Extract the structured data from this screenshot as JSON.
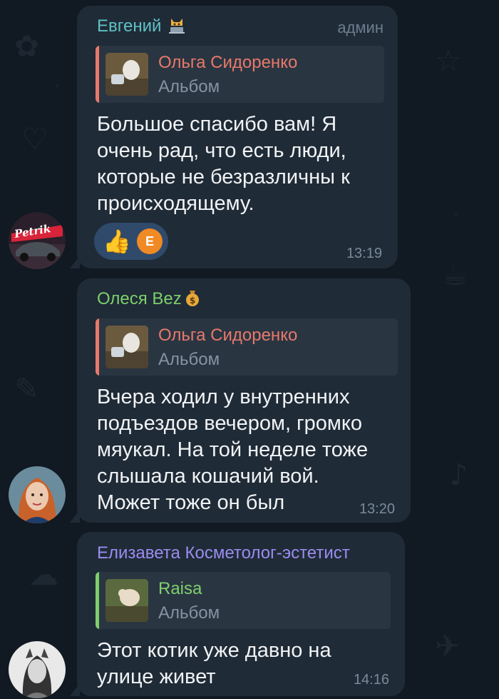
{
  "messages": [
    {
      "sender": "Евгений",
      "sender_color": "#5fc1c4",
      "sender_badge_icon": "cat-with-laptop-emoji-icon",
      "role": "админ",
      "reply": {
        "name": "Ольга Сидоренко",
        "name_color": "#e8796a",
        "subtitle": "Альбом"
      },
      "text": "Большое спасибо вам! Я\nочень рад, что есть люди,\nкоторые не безразличны к\nпроисходящему.",
      "reactions": {
        "emoji_icon": "thumbs-up-emoji-icon",
        "avatar_initial": "E"
      },
      "time": "13:19",
      "avatar_label": "Petrik"
    },
    {
      "sender": "Олеся Bez",
      "sender_color": "#7ecf6c",
      "sender_badge_icon": "money-bag-emoji-icon",
      "reply": {
        "name": "Ольга Сидоренко",
        "name_color": "#e8796a",
        "subtitle": "Альбом"
      },
      "text": "Вчера ходил у внутренних\nподъездов вечером, громко\nмяукал. На той неделе тоже\nслышала кошачий вой.\nМожет тоже он был",
      "time": "13:20"
    },
    {
      "sender": "Елизавета Косметолог-эстетист",
      "sender_color": "#9b8cf0",
      "reply": {
        "name": "Raisa",
        "name_color": "#7ecf6c",
        "subtitle": "Альбом"
      },
      "text": "Этот котик уже давно на\nулице живет",
      "time": "14:16"
    }
  ]
}
